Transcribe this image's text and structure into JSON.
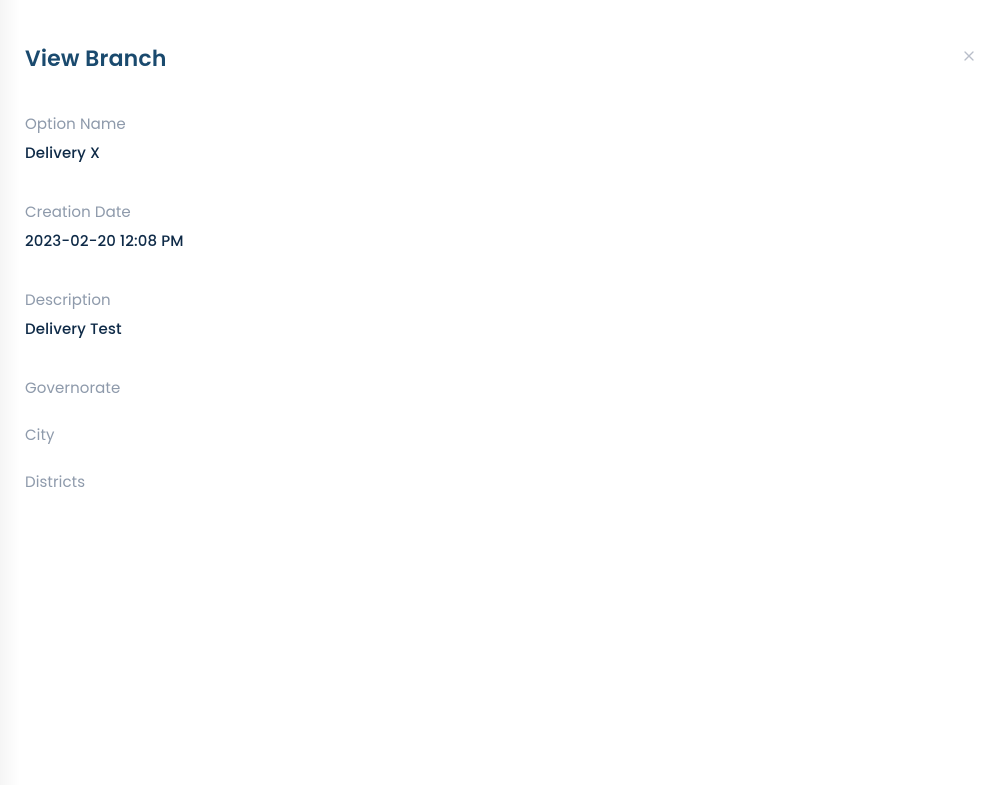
{
  "modal": {
    "title": "View Branch",
    "fields": {
      "optionName": {
        "label": "Option Name",
        "value": "Delivery X"
      },
      "creationDate": {
        "label": "Creation Date",
        "value": "2023-02-20 12:08 PM"
      },
      "description": {
        "label": "Description",
        "value": "Delivery Test"
      },
      "governorate": {
        "label": "Governorate",
        "value": ""
      },
      "city": {
        "label": "City",
        "value": ""
      },
      "districts": {
        "label": "Districts",
        "value": ""
      }
    }
  }
}
